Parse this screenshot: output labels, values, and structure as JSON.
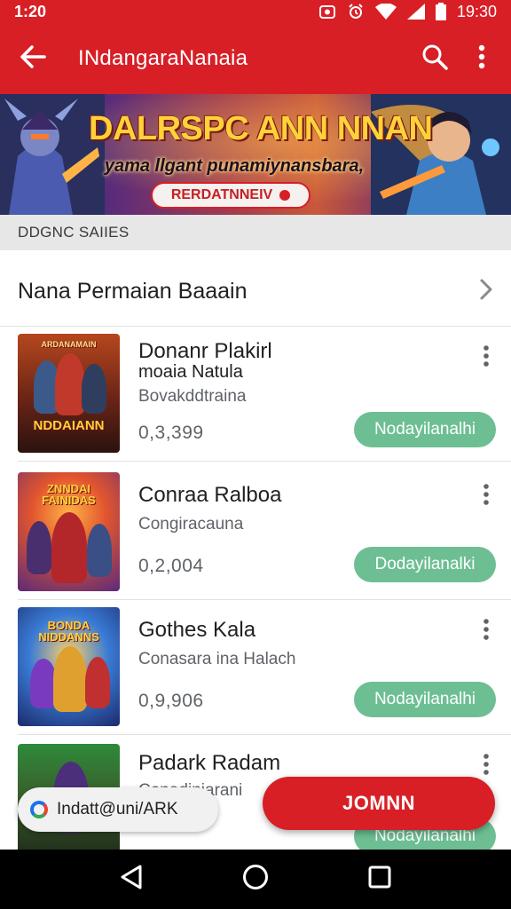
{
  "status_bar": {
    "time_left": "1:20",
    "time_right": "19:30",
    "icons": [
      "camera-icon",
      "alarm-icon",
      "wifi-icon",
      "signal-icon",
      "battery-icon"
    ]
  },
  "app_bar": {
    "title": "INdangaraNanaia",
    "icons": [
      "back-arrow-icon",
      "search-icon",
      "more-vert-icon"
    ]
  },
  "banner": {
    "headline": "DALRSPC ANN NNAN",
    "subheadline": "yama llgant punamiynansbara,",
    "cta_label": "RERDATNNEIV"
  },
  "section_strip": {
    "label": "DDGNC SAIIES"
  },
  "list_header": {
    "title": "Nana Permaian Baaain",
    "icon": "chevron-right-icon"
  },
  "games": [
    {
      "name": "Donanr Plakirl",
      "name2": "moaia Natula",
      "subtitle": "Bovakddtraina",
      "price": "0,3,399",
      "button_label": "Nodayilanalhi",
      "thumb_title": "NDDAIANN",
      "thumb_banner": "ARDANAMAIN"
    },
    {
      "name": "Conraa Ralboa",
      "subtitle": "Congiracauna",
      "price": "0,2,004",
      "button_label": "Dodayilanalki",
      "thumb_title": "ZNNDAI FAINIDAS"
    },
    {
      "name": "Gothes Kala",
      "subtitle": "Conasara ina Halach",
      "price": "0,9,906",
      "button_label": "Nodayilanalhi",
      "thumb_title": "BONDA NIDDANNS"
    },
    {
      "name": "Padark Radam",
      "subtitle": "Conadiniarani",
      "button_label": "Nodayilanalhi",
      "thumb_title": ""
    }
  ],
  "chip": {
    "label": "Indatt@uni/ARK",
    "icon": "chrome-icon"
  },
  "fab": {
    "label": "JOMNN"
  },
  "nav_bar": {
    "icons": [
      "back-triangle-icon",
      "home-circle-icon",
      "recents-square-icon"
    ]
  },
  "colors": {
    "primary": "#d81f26",
    "install_button": "#6dbf93",
    "strip": "#e7e7e7",
    "nav": "#000000"
  }
}
